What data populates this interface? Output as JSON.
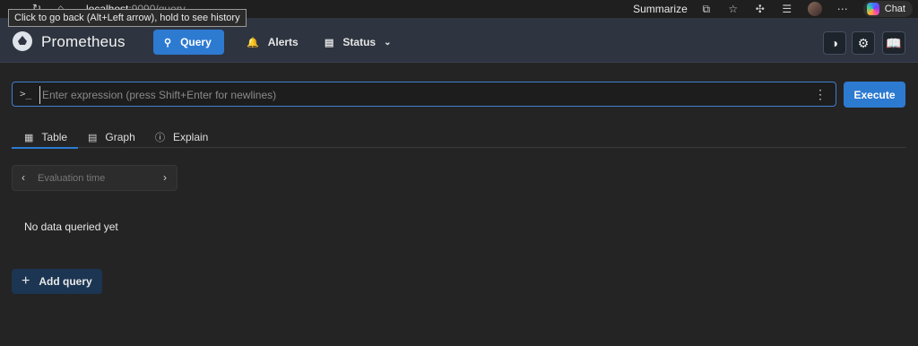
{
  "browser": {
    "url_host": "localhost",
    "url_path": ":9090/query",
    "tooltip": "Click to go back (Alt+Left arrow), hold to see history",
    "summarize_label": "Summarize",
    "chat_label": "Chat"
  },
  "header": {
    "brand": "Prometheus",
    "nav": [
      {
        "label": "Query",
        "icon": "search-icon",
        "active": true
      },
      {
        "label": "Alerts",
        "icon": "bell-icon"
      },
      {
        "label": "Status",
        "icon": "server-icon"
      }
    ]
  },
  "query": {
    "placeholder": "Enter expression (press Shift+Enter for newlines)",
    "execute_label": "Execute"
  },
  "tabs": [
    {
      "label": "Table",
      "icon": "table-icon",
      "active": true
    },
    {
      "label": "Graph",
      "icon": "graph-icon"
    },
    {
      "label": "Explain",
      "icon": "info-icon"
    }
  ],
  "eval_time_placeholder": "Evaluation time",
  "empty_message": "No data queried yet",
  "add_query_label": "Add query",
  "colors": {
    "accent": "#2d7ad1",
    "header_bg": "#2e3540",
    "page_bg": "#242424"
  }
}
